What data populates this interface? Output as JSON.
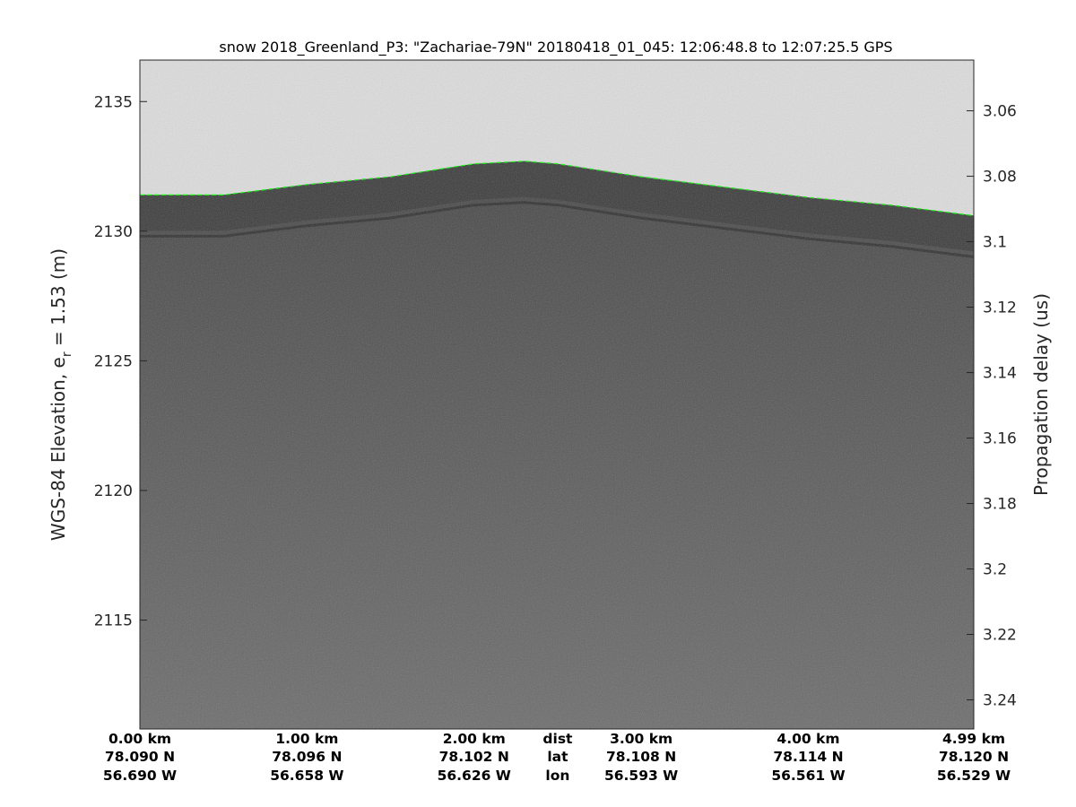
{
  "chart_data": {
    "type": "heatmap",
    "title": "snow 2018_Greenland_P3: \"Zachariae-79N\"  20180418_01_045: 12:06:48.8 to 12:07:25.5 GPS",
    "ylabel_left_main": "WGS-84 Elevation, e",
    "ylabel_left_sub": "r",
    "ylabel_left_tail": " = 1.53 (m)",
    "ylabel_right": "Propagation delay (us)",
    "colormap": "grayscale",
    "ylim_left": [
      2110.8,
      2136.6
    ],
    "ylim_right": [
      3.0445,
      3.2489
    ],
    "yticks_left": [
      2135,
      2130,
      2125,
      2120,
      2115
    ],
    "yticks_right": [
      "3.06",
      "3.08",
      "3.1",
      "3.12",
      "3.14",
      "3.16",
      "3.18",
      "3.2",
      "3.22",
      "3.24"
    ],
    "xlim_km": [
      0,
      4.99
    ],
    "bottom_labels": [
      {
        "dist": "0.00 km",
        "lat": "78.090 N",
        "lon": "56.690 W",
        "km": 0.0
      },
      {
        "dist": "1.00 km",
        "lat": "78.096 N",
        "lon": "56.658 W",
        "km": 1.0
      },
      {
        "dist": "2.00 km",
        "lat": "78.102 N",
        "lon": "56.626 W",
        "km": 2.0
      },
      {
        "dist": "3.00 km",
        "lat": "78.108 N",
        "lon": "56.593 W",
        "km": 3.0
      },
      {
        "dist": "4.00 km",
        "lat": "78.114 N",
        "lon": "56.561 W",
        "km": 4.0
      },
      {
        "dist": "4.99 km",
        "lat": "78.120 N",
        "lon": "56.529 W",
        "km": 4.99
      }
    ],
    "row_names": [
      "dist",
      "lat",
      "lon"
    ],
    "surface_track": {
      "color": "#22ee22",
      "km": [
        0,
        0.5,
        1.0,
        1.5,
        2.0,
        2.3,
        2.5,
        3.0,
        3.5,
        4.0,
        4.5,
        4.99
      ],
      "elevation_m": [
        2131.4,
        2131.4,
        2131.8,
        2132.1,
        2132.6,
        2132.7,
        2132.6,
        2132.1,
        2131.7,
        2131.3,
        2131.0,
        2130.6
      ]
    },
    "colors": {
      "air": "#dddddd",
      "layers": "#3a3a3a",
      "firn_top": "#454545",
      "firn_bottom": "#6c6c6c"
    }
  }
}
